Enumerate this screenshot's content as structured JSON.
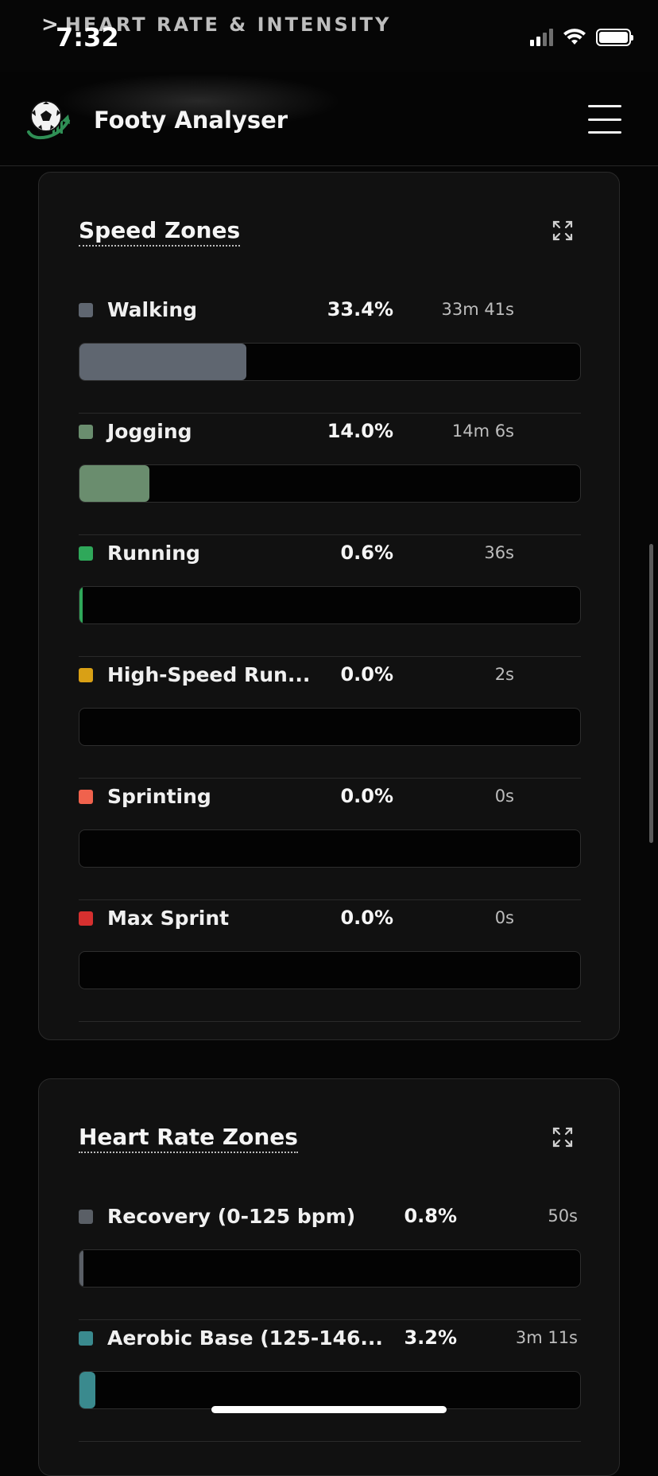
{
  "status_bar": {
    "time": "7:32",
    "overlay_title": "HEART RATE & INTENSITY"
  },
  "header": {
    "app_title": "Footy Analyser",
    "icons": [
      "soccer-ball-logo",
      "hamburger-menu-icon"
    ]
  },
  "speed_zones": {
    "title": "Speed Zones",
    "zones": [
      {
        "name": "Walking",
        "percent": "33.4%",
        "duration": "33m 41s",
        "fill": 0.334,
        "color": "#5f6670"
      },
      {
        "name": "Jogging",
        "percent": "14.0%",
        "duration": "14m 6s",
        "fill": 0.14,
        "color": "#6a8d6e"
      },
      {
        "name": "Running",
        "percent": "0.6%",
        "duration": "36s",
        "fill": 0.006,
        "color": "#2fa85a"
      },
      {
        "name": "High-Speed Run...",
        "percent": "0.0%",
        "duration": "2s",
        "fill": 0.0,
        "color": "#d9a015"
      },
      {
        "name": "Sprinting",
        "percent": "0.0%",
        "duration": "0s",
        "fill": 0.0,
        "color": "#f0624d"
      },
      {
        "name": "Max Sprint",
        "percent": "0.0%",
        "duration": "0s",
        "fill": 0.0,
        "color": "#d6302f"
      }
    ]
  },
  "heart_rate_zones": {
    "title": "Heart Rate Zones",
    "zones": [
      {
        "name": "Recovery (0-125 bpm)",
        "percent": "0.8%",
        "duration": "50s",
        "fill": 0.008,
        "color": "#5a5f66"
      },
      {
        "name": "Aerobic Base (125-146...",
        "percent": "3.2%",
        "duration": "3m 11s",
        "fill": 0.032,
        "color": "#3a8a8e"
      }
    ]
  }
}
